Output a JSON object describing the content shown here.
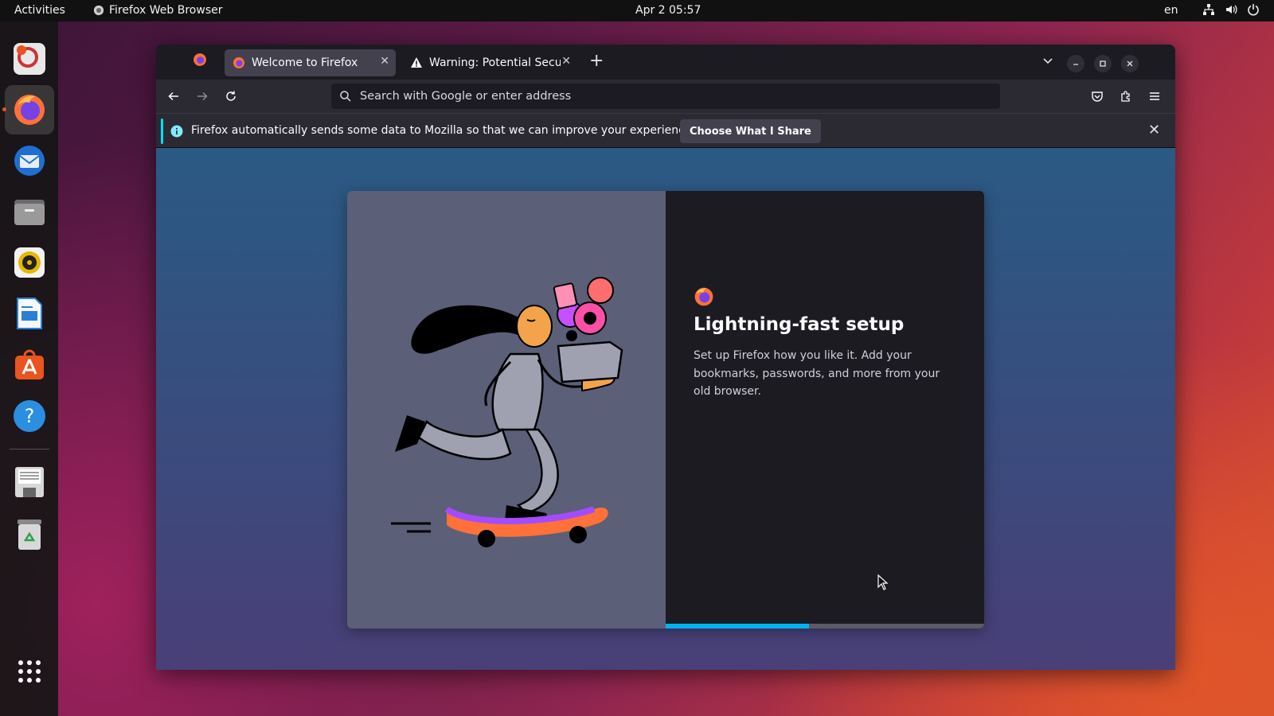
{
  "topbar": {
    "activities": "Activities",
    "app_name": "Firefox Web Browser",
    "clock": "Apr 2  05:57",
    "language": "en"
  },
  "dock": {
    "apps": [
      "help-icon-app",
      "firefox",
      "thunderbird",
      "files",
      "rhythmbox",
      "libreoffice-writer",
      "app-center",
      "help",
      "floppy-disk",
      "trash",
      "show-apps"
    ]
  },
  "browser": {
    "tabs": [
      {
        "title": "Welcome to Firefox",
        "icon": "firefox-icon",
        "selected": true
      },
      {
        "title": "Warning: Potential Security Risk Ahead",
        "icon": "warning-icon",
        "selected": false
      }
    ],
    "url_placeholder": "Search with Google or enter address",
    "notification": {
      "text": "Firefox automatically sends some data to Mozilla so that we can improve your experience.",
      "button": "Choose What I Share"
    },
    "onboarding": {
      "title": "Lightning-fast setup",
      "body": "Set up Firefox how you like it. Add your bookmarks, passwords, and more from your old browser.",
      "progress": 0.45
    }
  },
  "colors": {
    "accent": "#00b3f4",
    "ubuntu_orange": "#e95420",
    "toolbar": "#2b2a33",
    "tabbar": "#1c1b22"
  }
}
